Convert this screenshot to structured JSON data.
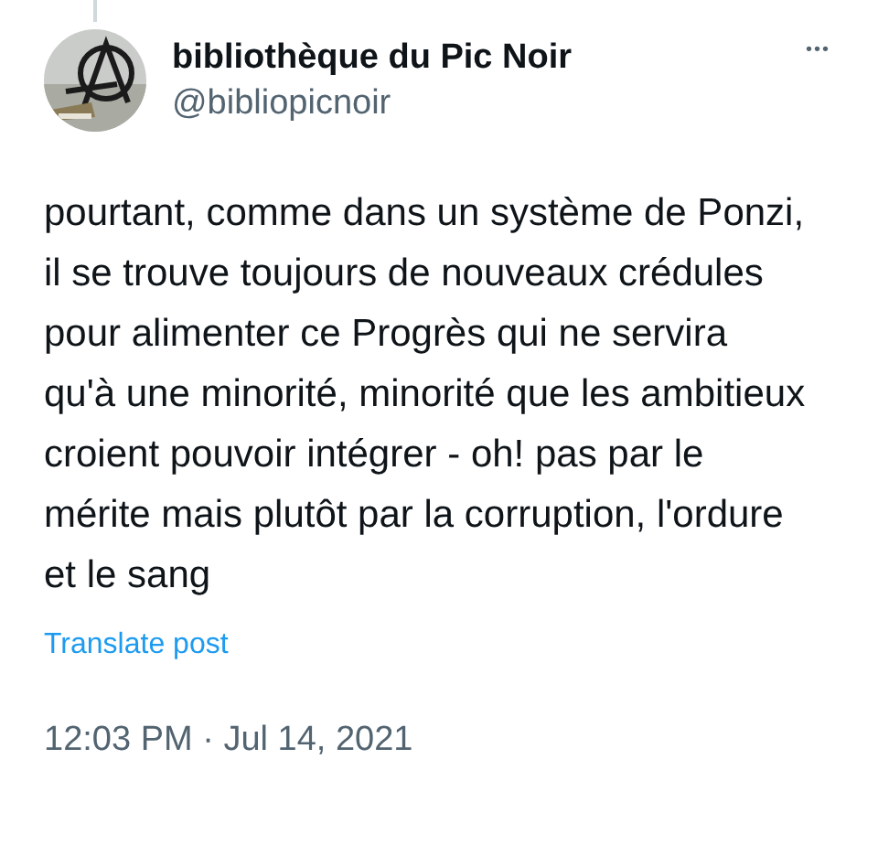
{
  "author": {
    "name": "bibliothèque du Pic Noir",
    "handle": "@bibliopicnoir"
  },
  "more": "•••",
  "body": "pourtant, comme dans un système de Ponzi, il se trouve toujours de nouveaux crédules pour alimenter ce Progrès qui ne servira qu'à une minorité, minorité que les ambitieux croient pouvoir intégrer - oh! pas par le mérite mais plutôt par la corruption, l'ordure et le sang",
  "translate": "Translate post",
  "timestamp": "12:03 PM · Jul 14, 2021"
}
